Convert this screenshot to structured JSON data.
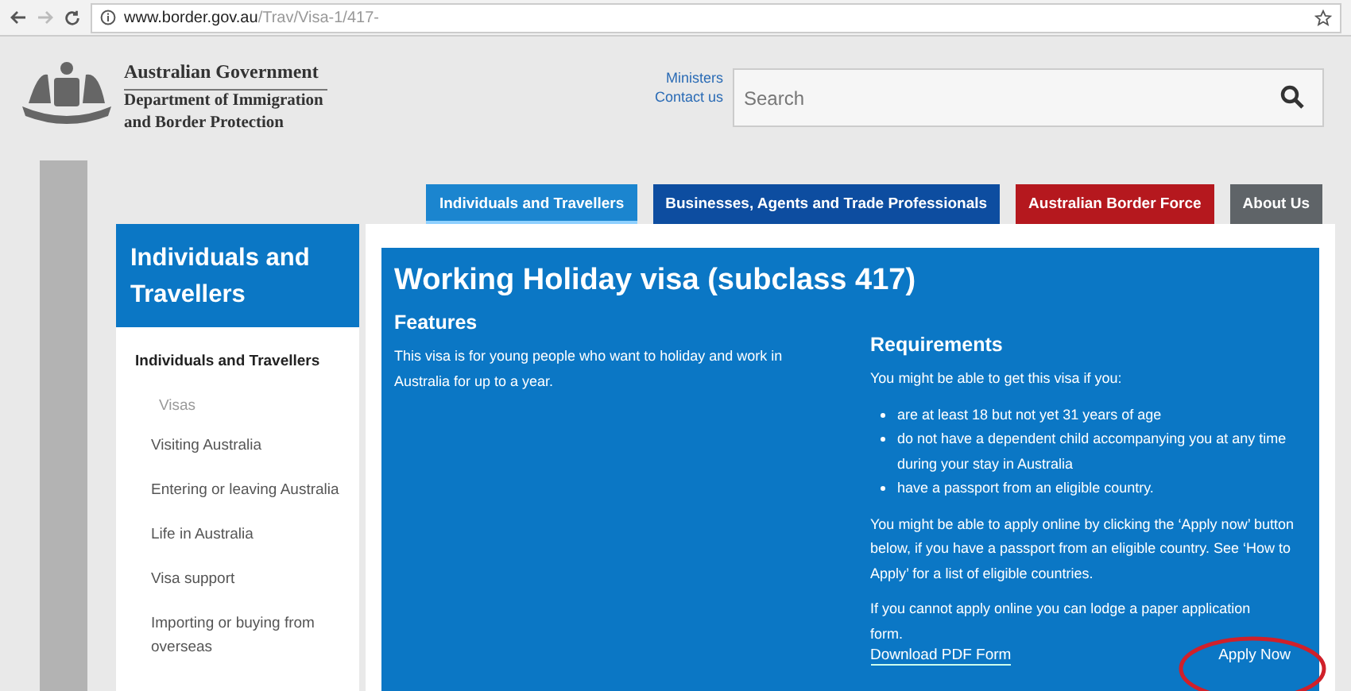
{
  "browser": {
    "url_host": "www.border.gov.au",
    "url_path": "/Trav/Visa-1/417-"
  },
  "header": {
    "agency": "Australian Government",
    "department": [
      "Department of Immigration",
      "and Border Protection"
    ],
    "links": [
      "Ministers",
      "Contact us"
    ],
    "search": {
      "placeholder": "Search"
    }
  },
  "nav_tabs": [
    {
      "label": "Individuals and Travellers",
      "selected": true,
      "color": "#1b85cf"
    },
    {
      "label": "Businesses, Agents and Trade Professionals",
      "selected": false,
      "color": "#0d4da0"
    },
    {
      "label": "Australian Border Force",
      "selected": false,
      "color": "#b5181e"
    },
    {
      "label": "About Us",
      "selected": false,
      "color": "#5f6468"
    }
  ],
  "sidebar": {
    "title": "Individuals and Travellers",
    "items": [
      {
        "label": "Individuals and Travellers",
        "selected": true,
        "children": [
          {
            "label": "Visas",
            "selected": false
          }
        ]
      },
      {
        "label": "Visiting Australia",
        "selected": false
      },
      {
        "label": "Entering or leaving Australia",
        "selected": false
      },
      {
        "label": "Life in Australia",
        "selected": false
      },
      {
        "label": "Visa support",
        "selected": false
      },
      {
        "label": "Importing or buying from overseas",
        "selected": false
      }
    ]
  },
  "main": {
    "title": "Working Holiday visa (subclass 417)",
    "features": {
      "heading": "Features",
      "text": "This visa is for young people who want to holiday and work in Australia for up to a year."
    },
    "requirements": {
      "heading": "Requirements",
      "intro": "You might be able to get this visa if you:",
      "bullets": [
        "are at least 18 but not yet 31 years of age",
        "do not have a dependent child accompanying you at any time during your stay in Australia",
        "have a passport from an eligible country."
      ],
      "online": "You might be able to apply online by clicking the ‘Apply now’ button below, if you have a passport from an eligible country. See ‘How to Apply’ for a list of eligible countries.",
      "paper": "If you cannot apply online you can lodge a paper application form.",
      "download": "Download PDF Form",
      "apply": "Apply Now"
    }
  }
}
